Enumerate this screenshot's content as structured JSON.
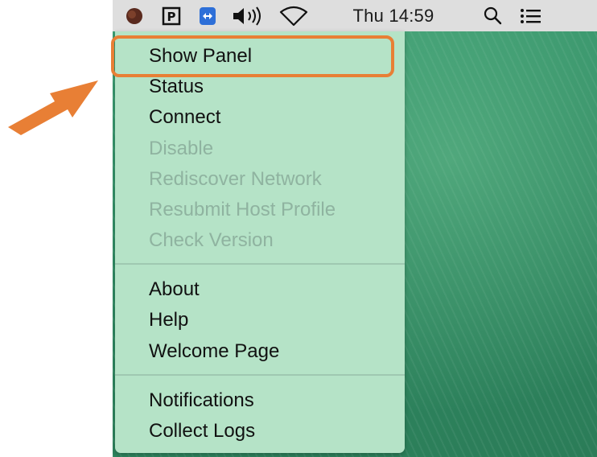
{
  "menubar": {
    "clock": "Thu 14:59",
    "icons": [
      "app-status-icon",
      "parking-icon",
      "teamviewer-icon",
      "volume-icon",
      "wifi-icon",
      "search-icon",
      "notification-center-icon"
    ]
  },
  "menu": {
    "items": [
      {
        "label": "Show Panel",
        "enabled": true
      },
      {
        "label": "Status",
        "enabled": true
      },
      {
        "label": "Connect",
        "enabled": true
      },
      {
        "label": "Disable",
        "enabled": false
      },
      {
        "label": "Rediscover Network",
        "enabled": false
      },
      {
        "label": "Resubmit Host Profile",
        "enabled": false
      },
      {
        "label": "Check Version",
        "enabled": false
      },
      {
        "label": "About",
        "enabled": true
      },
      {
        "label": "Help",
        "enabled": true
      },
      {
        "label": "Welcome Page",
        "enabled": true
      },
      {
        "label": "Notifications",
        "enabled": true
      },
      {
        "label": "Collect Logs",
        "enabled": true
      }
    ]
  },
  "colors": {
    "highlight": "#e87f35",
    "menu_background": "#b5e3c7",
    "menubar_background": "#dedede"
  }
}
